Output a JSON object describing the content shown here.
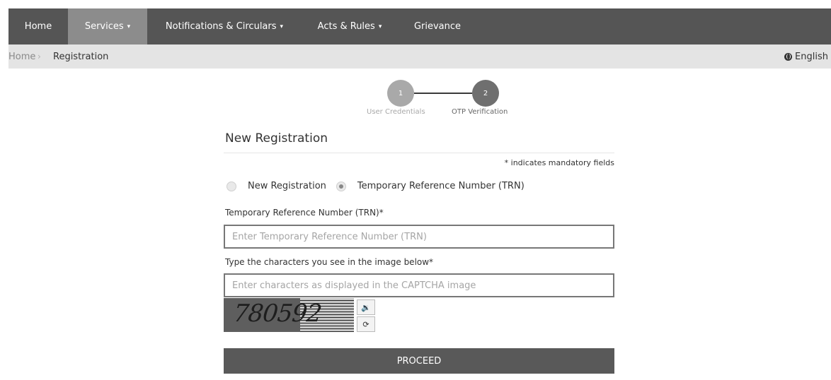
{
  "nav": {
    "items": [
      {
        "label": "Home",
        "dropdown": false,
        "active": false
      },
      {
        "label": "Services",
        "dropdown": true,
        "active": true
      },
      {
        "label": "Notifications & Circulars",
        "dropdown": true,
        "active": false
      },
      {
        "label": "Acts & Rules",
        "dropdown": true,
        "active": false
      },
      {
        "label": "Grievance",
        "dropdown": false,
        "active": false
      }
    ]
  },
  "breadcrumb": {
    "home": "Home",
    "separator": "›",
    "current": "Registration"
  },
  "language": {
    "label": "English",
    "icon": "globe-icon"
  },
  "stepper": {
    "steps": [
      {
        "number": "1",
        "label": "User Credentials"
      },
      {
        "number": "2",
        "label": "OTP Verification"
      }
    ],
    "current_step": 2
  },
  "form": {
    "title": "New Registration",
    "mandatory_note": "* indicates mandatory fields",
    "radio_options": [
      {
        "label": "New Registration",
        "checked": false
      },
      {
        "label": "Temporary Reference Number (TRN)",
        "checked": true
      }
    ],
    "trn_label": "Temporary Reference Number (TRN)*",
    "trn_placeholder": "Enter Temporary Reference Number (TRN)",
    "captcha_label": "Type the characters you see in the image below*",
    "captcha_placeholder": "Enter characters as displayed in the CAPTCHA image",
    "captcha_text": "780592",
    "audio_icon": "speaker-icon",
    "refresh_icon": "refresh-icon",
    "proceed_label": "PROCEED"
  },
  "colors": {
    "navbar": "#555555",
    "nav_active": "#8c8c8c",
    "breadcrumb_bg": "#e4e4e4",
    "proceed_bg": "#595959"
  }
}
